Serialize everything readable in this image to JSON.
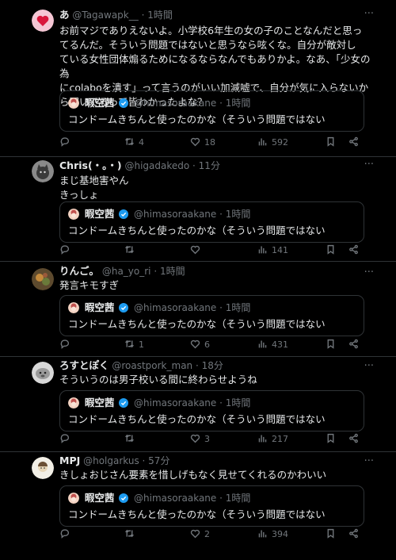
{
  "quoted": {
    "name": "暇空茜",
    "handle": "@himasoraakane",
    "time": "· 1時間",
    "text": "コンドームきちんと使ったのかな（そういう問題ではない"
  },
  "tweets": [
    {
      "name": "あ",
      "handle": "@Tagawapk__",
      "time": "· 1時間",
      "text": "お前マジでありえないよ。小学校6年生の女の子のことなんだと思っ\nてるんだ。そういう問題ではないと思うなら呟くな。自分が敵対し\nている女性団体煽るためになるならなんでもありかよ。なあ、「少女の為\nにcolaboを潰す」って言うのがいい加減嘘で、自分が気に入らないか\nら叩いてるって皆わかったよな？",
      "replies": "",
      "retweets": "4",
      "likes": "18",
      "views": "592"
    },
    {
      "name": "Chris(・。・)",
      "handle": "@higadakedo",
      "time": "· 11分",
      "text": "まじ基地害やん\nきっしょ",
      "replies": "",
      "retweets": "",
      "likes": "",
      "views": "141"
    },
    {
      "name": "りんご。",
      "handle": "@ha_yo_ri",
      "time": "· 1時間",
      "text": "発言キモすぎ",
      "replies": "",
      "retweets": "1",
      "likes": "6",
      "views": "431"
    },
    {
      "name": "ろすとぽく",
      "handle": "@roastpork_man",
      "time": "· 18分",
      "text": "そういうのは男子校いる間に終わらせようね",
      "replies": "",
      "retweets": "",
      "likes": "3",
      "views": "217"
    },
    {
      "name": "MPJ",
      "handle": "@holgarkus",
      "time": "· 57分",
      "text": "きしょおじさん要素を惜しげもなく見せてくれるのかわいい",
      "replies": "",
      "retweets": "",
      "likes": "2",
      "views": "394"
    }
  ],
  "icons": {
    "reply": "reply-icon",
    "retweet": "retweet-icon",
    "like": "heart-icon",
    "views": "views-icon",
    "bookmark": "bookmark-icon",
    "share": "share-icon",
    "more": "more-icon",
    "verified": "verified-badge-icon"
  },
  "colors": {
    "background": "#000000",
    "text": "#e7e9ea",
    "muted": "#71767b",
    "border": "#2f3336",
    "verified": "#1d9bf0"
  }
}
